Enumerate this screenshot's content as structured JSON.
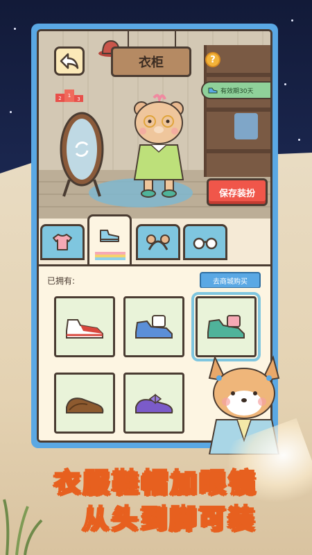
{
  "header": {
    "title": "衣柜",
    "validity": "有效期30天",
    "help": "?",
    "podium_numbers": [
      "2",
      "1",
      "3"
    ]
  },
  "actions": {
    "save_label": "保存装扮",
    "shop_label": "去商城购买"
  },
  "tabs": [
    {
      "name": "tops",
      "icon": "shirt-icon",
      "active": false
    },
    {
      "name": "shoes",
      "icon": "shoe-icon",
      "active": true
    },
    {
      "name": "headwear",
      "icon": "bear-ears-headband-icon",
      "active": false
    },
    {
      "name": "glasses",
      "icon": "glasses-icon",
      "active": false
    }
  ],
  "inventory": {
    "owned_label": "已拥有:",
    "items": [
      {
        "name": "red-white-sneakers",
        "color": "#d8473d",
        "selected": false
      },
      {
        "name": "blue-white-sneakers",
        "color": "#5b8fd8",
        "selected": false
      },
      {
        "name": "green-pink-sneakers",
        "color": "#4fb39a",
        "selected": true
      },
      {
        "name": "brown-leather-shoes",
        "color": "#8d5a2f",
        "selected": false
      },
      {
        "name": "purple-bow-shoes",
        "color": "#7b5bc9",
        "selected": false
      }
    ]
  },
  "promo": {
    "line1": "衣服鞋帽加眼镜",
    "line2": "从头到脚可装"
  },
  "colors": {
    "panel": "#5aa8e4",
    "save": "#f0564a",
    "promo_stroke": "#e7601f"
  }
}
